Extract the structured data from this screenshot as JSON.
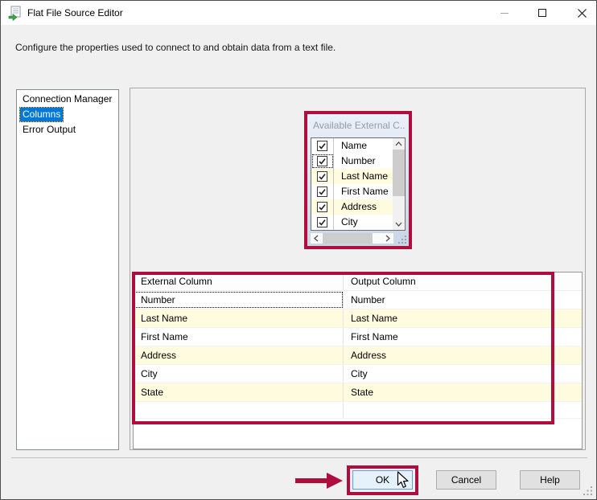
{
  "window": {
    "title": "Flat File Source Editor",
    "description": "Configure the properties used to connect to and obtain data from a text file."
  },
  "icons": {
    "app": "document-with-green-arrow",
    "minimize": "–",
    "maximize": "□",
    "close": "✕",
    "scroll_up": "∧",
    "scroll_down": "∨",
    "scroll_left": "‹",
    "scroll_right": "›",
    "checkbox_check": "✓",
    "cursor": "arrow-pointer",
    "annotation_arrow": "red-arrow-right",
    "resize_grip": "dot-triangle"
  },
  "sidebar": {
    "items": [
      {
        "label": "Connection Manager",
        "selected": false
      },
      {
        "label": "Columns",
        "selected": true
      },
      {
        "label": "Error Output",
        "selected": false
      }
    ]
  },
  "available_columns": {
    "title": "Available External C...",
    "rows": [
      {
        "label": "Name",
        "checked": true,
        "highlighted": false,
        "focused": false
      },
      {
        "label": "Number",
        "checked": true,
        "highlighted": false,
        "focused": true
      },
      {
        "label": "Last Name",
        "checked": true,
        "highlighted": true,
        "focused": false
      },
      {
        "label": "First Name",
        "checked": true,
        "highlighted": false,
        "focused": false
      },
      {
        "label": "Address",
        "checked": true,
        "highlighted": true,
        "focused": false
      },
      {
        "label": "City",
        "checked": true,
        "highlighted": false,
        "focused": false
      }
    ]
  },
  "mapping_table": {
    "headers": [
      "External Column",
      "Output Column"
    ],
    "rows": [
      {
        "external": "Number",
        "output": "Number",
        "highlighted": false,
        "focused": true
      },
      {
        "external": "Last Name",
        "output": "Last Name",
        "highlighted": true,
        "focused": false
      },
      {
        "external": "First Name",
        "output": "First Name",
        "highlighted": false,
        "focused": false
      },
      {
        "external": "Address",
        "output": "Address",
        "highlighted": true,
        "focused": false
      },
      {
        "external": "City",
        "output": "City",
        "highlighted": false,
        "focused": false
      },
      {
        "external": "State",
        "output": "State",
        "highlighted": true,
        "focused": false
      }
    ]
  },
  "footer": {
    "ok": "OK",
    "cancel": "Cancel",
    "help": "Help"
  },
  "colors": {
    "annotation_red": "#b00d3f",
    "selection_blue": "#0078d7",
    "row_highlight_yellow": "#fffbdf",
    "ok_button_bg": "#e5f1fb",
    "titlebar_bg": "#ffffff",
    "body_bg": "#f0f0f0"
  }
}
